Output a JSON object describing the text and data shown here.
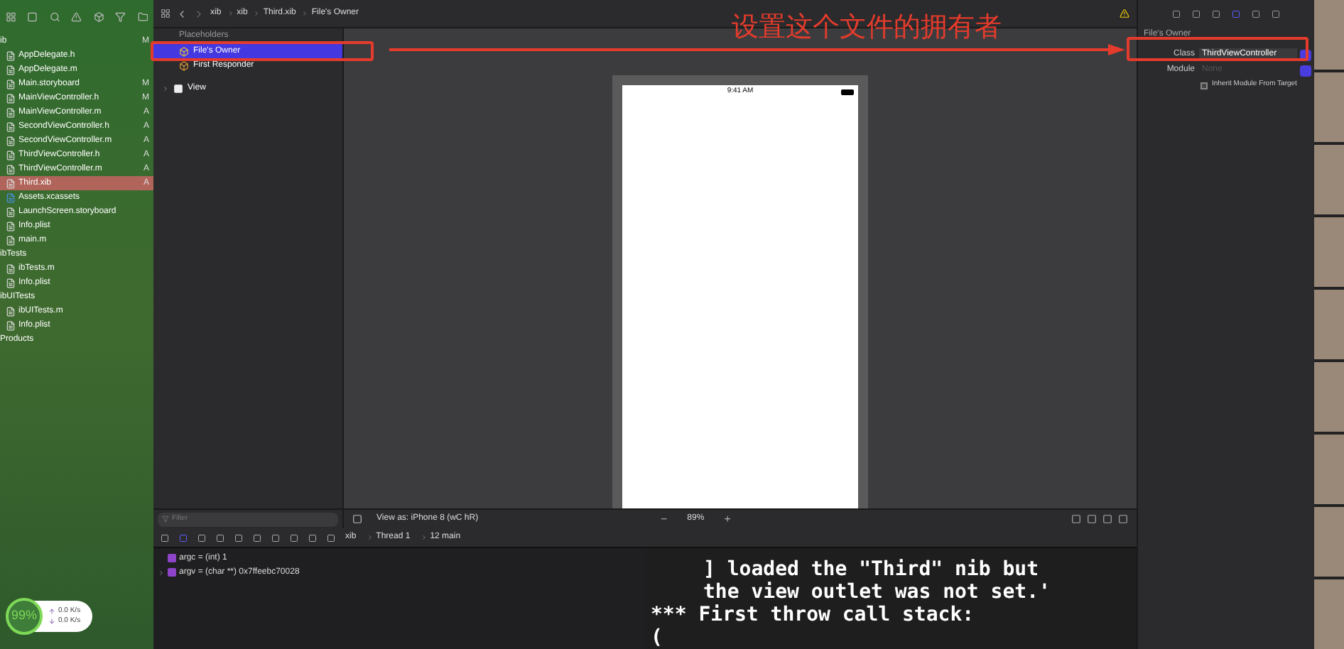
{
  "navigator": {
    "groups": [
      {
        "name": "ib",
        "status": "M",
        "children": [
          {
            "name": "AppDelegate.h",
            "kind": "header",
            "selected": false
          },
          {
            "name": "AppDelegate.m",
            "kind": "source",
            "selected": false
          },
          {
            "name": "Main.storyboard",
            "kind": "storyboard",
            "status": "M",
            "selected": false
          },
          {
            "name": "MainViewController.h",
            "kind": "header",
            "status": "M",
            "selected": false
          },
          {
            "name": "MainViewController.m",
            "kind": "source",
            "status": "A",
            "selected": false
          },
          {
            "name": "SecondViewController.h",
            "kind": "header",
            "status": "A",
            "selected": false
          },
          {
            "name": "SecondViewController.m",
            "kind": "source",
            "status": "A",
            "selected": false
          },
          {
            "name": "ThirdViewController.h",
            "kind": "header",
            "status": "A",
            "selected": false
          },
          {
            "name": "ThirdViewController.m",
            "kind": "source",
            "status": "A",
            "selected": false
          },
          {
            "name": "Third.xib",
            "kind": "xib",
            "status": "A",
            "selected": true
          },
          {
            "name": "Assets.xcassets",
            "kind": "assets",
            "selected": false
          },
          {
            "name": "LaunchScreen.storyboard",
            "kind": "storyboard",
            "selected": false
          },
          {
            "name": "Info.plist",
            "kind": "plist",
            "selected": false
          },
          {
            "name": "main.m",
            "kind": "source",
            "selected": false
          }
        ]
      },
      {
        "name": "ibTests",
        "children": [
          {
            "name": "ibTests.m",
            "kind": "source",
            "selected": false
          },
          {
            "name": "Info.plist",
            "kind": "plist",
            "selected": false
          }
        ]
      },
      {
        "name": "ibUITests",
        "children": [
          {
            "name": "ibUITests.m",
            "kind": "source",
            "selected": false
          },
          {
            "name": "Info.plist",
            "kind": "plist",
            "selected": false
          }
        ]
      },
      {
        "name": "Products"
      }
    ]
  },
  "breadcrumb": [
    "xib",
    "xib",
    "Third.xib",
    "File's Owner"
  ],
  "outline": {
    "header": "Placeholders",
    "items": [
      {
        "name": "File's Owner",
        "kind": "owner",
        "selected": true
      },
      {
        "name": "First Responder",
        "kind": "responder",
        "selected": false
      },
      {
        "name": "View",
        "kind": "view",
        "selected": false
      }
    ],
    "filter_placeholder": "Filter"
  },
  "canvas": {
    "status_time": "9:41 AM",
    "view_as": "View as: iPhone 8 (wC hR)",
    "zoom": "89%",
    "zoom_out": "−",
    "zoom_in": "+"
  },
  "annotation": {
    "text": "设置这个文件的拥有者"
  },
  "inspector": {
    "title": "File's Owner",
    "class_label": "Class",
    "class_value": "ThirdViewController",
    "module_label": "Module",
    "module_placeholder": "None",
    "inherit_label": "Inherit Module From Target",
    "inherit_checked": false
  },
  "debug": {
    "breadcrumb": [
      "xib",
      "Thread 1",
      "12 main"
    ],
    "variables": [
      {
        "name": "argc = (int) 1",
        "expandable": false
      },
      {
        "name": "argv = (char **) 0x7ffeebc70028",
        "expandable": true
      }
    ]
  },
  "console": {
    "lines": [
      "] loaded the \"Third\" nib but",
      "the view outlet was not set.'",
      "*** First throw call stack:",
      "("
    ]
  },
  "monitor": {
    "percent": "99%",
    "upload": "0.0 K/s",
    "download": "0.0 K/s"
  }
}
